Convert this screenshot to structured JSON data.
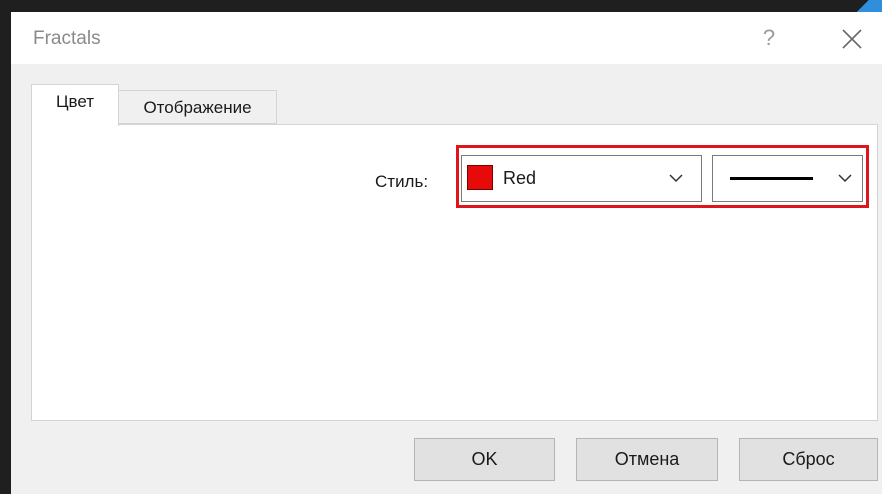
{
  "window": {
    "title": "Fractals",
    "help_glyph": "?",
    "help_icon": "question-mark-icon",
    "close_icon": "close-x-icon"
  },
  "tabs": [
    {
      "label": "Цвет",
      "active": true
    },
    {
      "label": "Отображение",
      "active": false
    }
  ],
  "style_row": {
    "label": "Стиль:",
    "color_select": {
      "value": "Red",
      "swatch_color": "#e60a0a"
    },
    "line_select": {
      "value": "solid-line"
    }
  },
  "buttons": {
    "ok": "OK",
    "cancel": "Отмена",
    "reset": "Сброс"
  },
  "colors": {
    "highlight": "#e0151b",
    "dialog_bg": "#f0f0f0"
  }
}
